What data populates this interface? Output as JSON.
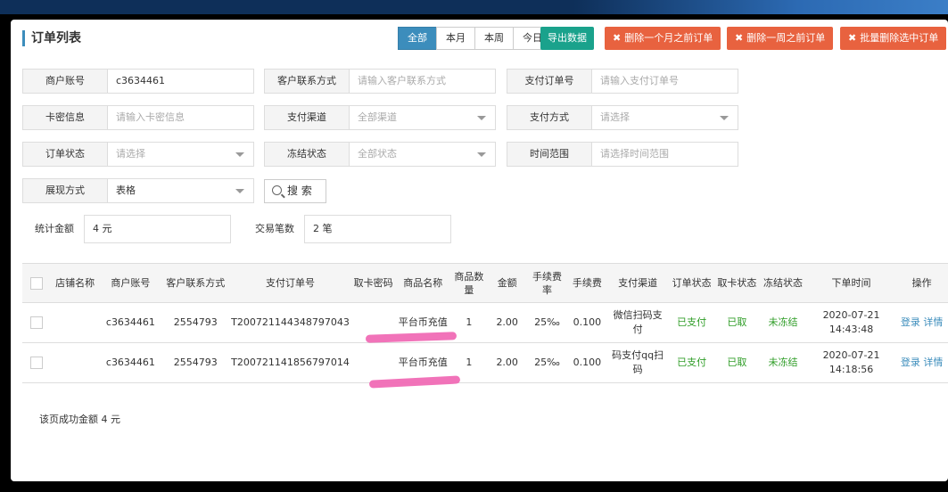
{
  "page": {
    "title": "订单列表"
  },
  "time_filter": {
    "options": [
      "全部",
      "本月",
      "本周",
      "今日"
    ],
    "active": "全部"
  },
  "toolbar": {
    "export_label": "导出数据",
    "delete_month_label": "删除一个月之前订单",
    "delete_week_label": "删除一周之前订单",
    "batch_delete_label": "批量删除选中订单"
  },
  "filters": {
    "merchant_account": {
      "label": "商户账号",
      "value": "c3634461"
    },
    "customer_contact": {
      "label": "客户联系方式",
      "placeholder": "请输入客户联系方式"
    },
    "payment_order_no": {
      "label": "支付订单号",
      "placeholder": "请输入支付订单号"
    },
    "card_info": {
      "label": "卡密信息",
      "placeholder": "请输入卡密信息"
    },
    "payment_channel": {
      "label": "支付渠道",
      "value": "全部渠道"
    },
    "payment_method": {
      "label": "支付方式",
      "value": "请选择"
    },
    "order_status": {
      "label": "订单状态",
      "value": "请选择"
    },
    "freeze_status": {
      "label": "冻结状态",
      "value": "全部状态"
    },
    "time_range": {
      "label": "时间范围",
      "placeholder": "请选择时间范围"
    },
    "display_mode": {
      "label": "展现方式",
      "value": "表格"
    },
    "search_label": "搜 索"
  },
  "stats": {
    "amount_label": "统计金额",
    "amount_value": "4 元",
    "count_label": "交易笔数",
    "count_value": "2 笔"
  },
  "table": {
    "headers": [
      "店铺名称",
      "商户账号",
      "客户联系方式",
      "支付订单号",
      "取卡密码",
      "商品名称",
      "商品数量",
      "金额",
      "手续费率",
      "手续费",
      "支付渠道",
      "订单状态",
      "取卡状态",
      "冻结状态",
      "下单时间",
      "操作"
    ],
    "rows": [
      {
        "shop": "",
        "merchant": "c3634461",
        "contact": "2554793",
        "order_no": "T200721144348797043",
        "card_pwd": "",
        "product": "平台币充值",
        "qty": "1",
        "amount": "2.00",
        "fee_rate": "25‰",
        "fee": "0.100",
        "channel": "微信扫码支付",
        "order_status": "已支付",
        "card_status": "已取",
        "freeze_status": "未冻结",
        "time": "2020-07-21 14:43:48",
        "action_login": "登录",
        "action_detail": "详情"
      },
      {
        "shop": "",
        "merchant": "c3634461",
        "contact": "2554793",
        "order_no": "T200721141856797014",
        "card_pwd": "",
        "product": "平台币充值",
        "qty": "1",
        "amount": "2.00",
        "fee_rate": "25‰",
        "fee": "0.100",
        "channel": "码支付qq扫码",
        "order_status": "已支付",
        "card_status": "已取",
        "freeze_status": "未冻结",
        "time": "2020-07-21 14:18:56",
        "action_login": "登录",
        "action_detail": "详情"
      }
    ]
  },
  "footer": {
    "note": "该页成功金额 4 元"
  },
  "colors": {
    "accent": "#3c8dbc",
    "export": "#1aa28c",
    "danger": "#e8623f",
    "success": "#2f9d27",
    "highlight": "#f06bb5"
  }
}
